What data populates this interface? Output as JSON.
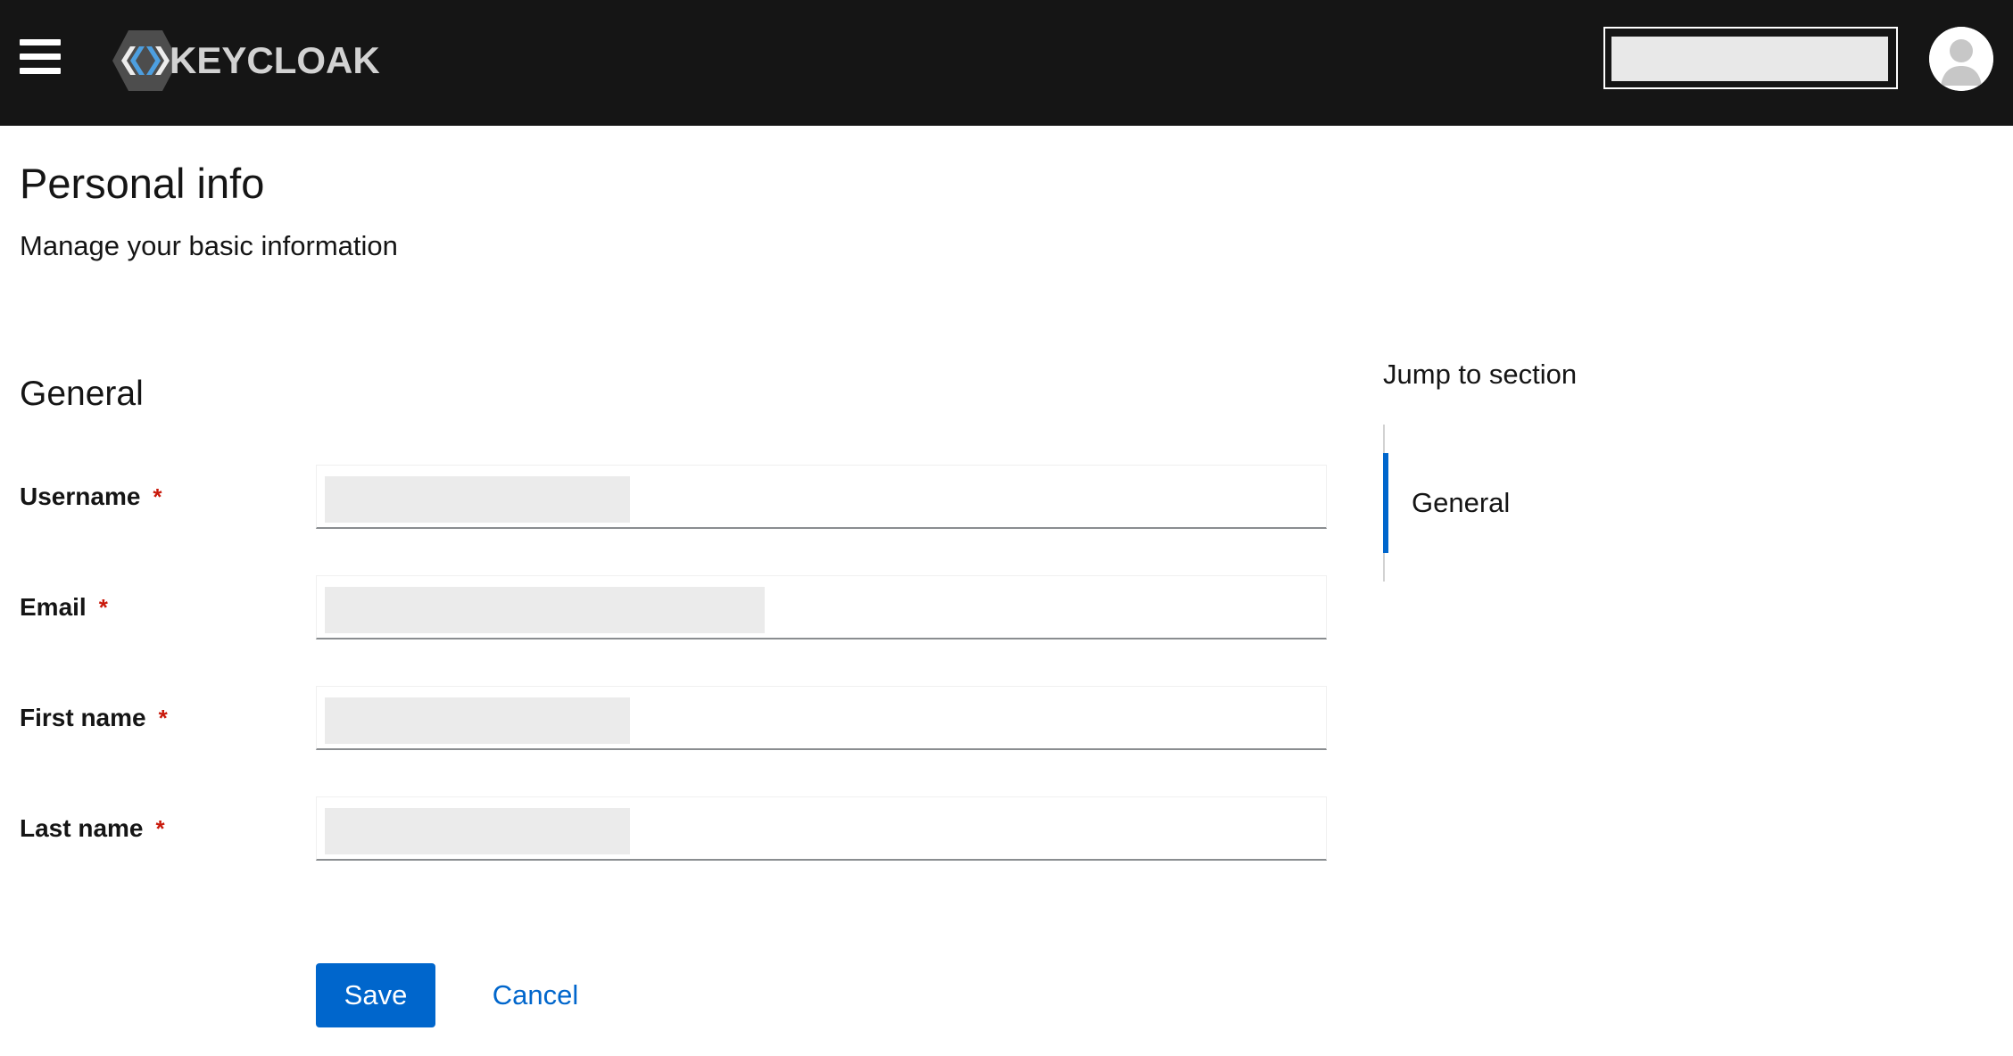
{
  "header": {
    "brand": "KEYCLOAK",
    "menu_icon": "hamburger-menu-icon",
    "user_icon": "user-avatar-icon",
    "colors": {
      "background": "#151515",
      "brand_text": "#d2d2d2",
      "logo_blue": "#4d9fe0"
    }
  },
  "page": {
    "title": "Personal info",
    "subtitle": "Manage your basic information"
  },
  "form": {
    "section_title": "General",
    "required_marker": "*",
    "fields": [
      {
        "label": "Username"
      },
      {
        "label": "Email"
      },
      {
        "label": "First name"
      },
      {
        "label": "Last name"
      }
    ],
    "save_label": "Save",
    "cancel_label": "Cancel",
    "colors": {
      "primary": "#0066cc",
      "required": "#c9190b"
    }
  },
  "jump": {
    "heading": "Jump to section",
    "items": [
      {
        "label": "General",
        "active": true
      }
    ]
  }
}
